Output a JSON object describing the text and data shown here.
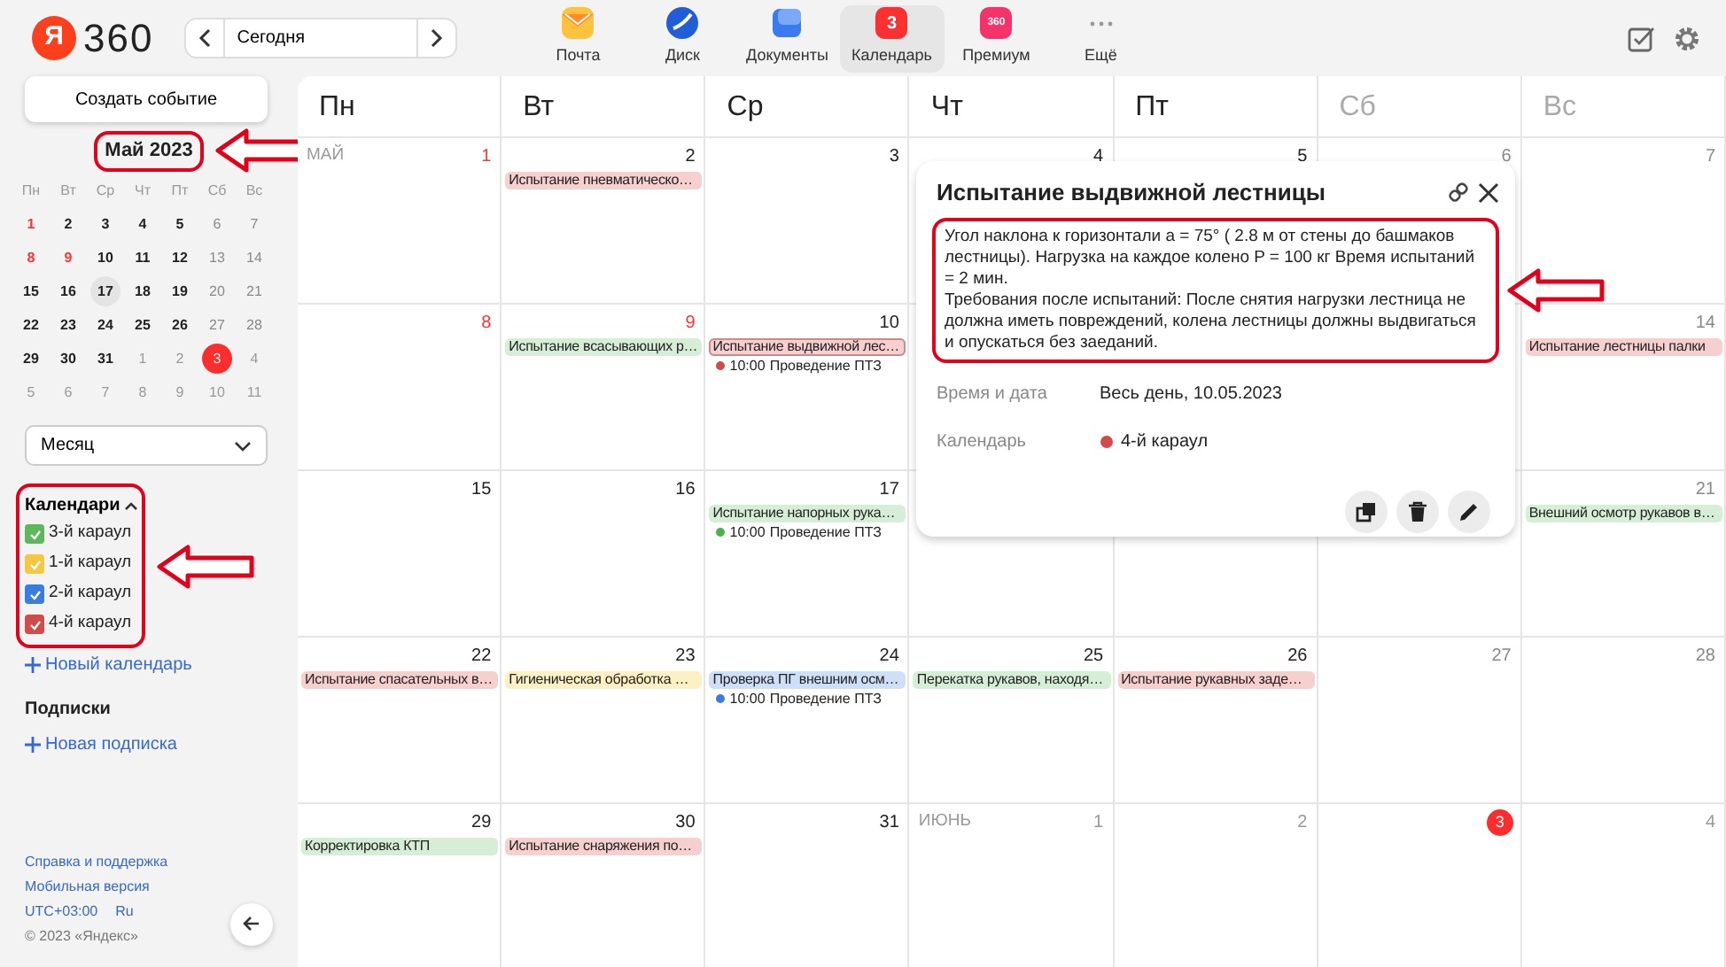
{
  "header": {
    "logo_letter": "Я",
    "logo_text": "360",
    "today_button": "Сегодня",
    "services": [
      {
        "label": "Почта",
        "kind": "mail",
        "selected": false
      },
      {
        "label": "Диск",
        "kind": "disk",
        "selected": false
      },
      {
        "label": "Документы",
        "kind": "docs",
        "selected": false
      },
      {
        "label": "Календарь",
        "kind": "calendar",
        "icon_text": "3",
        "selected": true
      },
      {
        "label": "Премиум",
        "kind": "premium",
        "icon_text": "360",
        "selected": false
      },
      {
        "label": "Ещё",
        "kind": "more",
        "selected": false
      }
    ]
  },
  "sidebar": {
    "create_button": "Создать событие",
    "mini_calendar": {
      "title": "Май 2023",
      "highlighted": true,
      "weekdays": [
        "Пн",
        "Вт",
        "Ср",
        "Чт",
        "Пт",
        "Сб",
        "Вс"
      ],
      "weeks": [
        [
          {
            "text": "1",
            "kind": "holiday",
            "selected": false
          },
          {
            "text": "2",
            "kind": "normal",
            "selected": false
          },
          {
            "text": "3",
            "kind": "normal",
            "selected": false
          },
          {
            "text": "4",
            "kind": "normal",
            "selected": false
          },
          {
            "text": "5",
            "kind": "normal",
            "selected": false
          },
          {
            "text": "6",
            "kind": "weekend",
            "selected": false
          },
          {
            "text": "7",
            "kind": "weekend",
            "selected": false
          }
        ],
        [
          {
            "text": "8",
            "kind": "holiday",
            "selected": false
          },
          {
            "text": "9",
            "kind": "holiday",
            "selected": false
          },
          {
            "text": "10",
            "kind": "normal",
            "selected": false
          },
          {
            "text": "11",
            "kind": "normal",
            "selected": false
          },
          {
            "text": "12",
            "kind": "normal",
            "selected": false
          },
          {
            "text": "13",
            "kind": "weekend",
            "selected": false
          },
          {
            "text": "14",
            "kind": "weekend",
            "selected": false
          }
        ],
        [
          {
            "text": "15",
            "kind": "normal",
            "selected": false
          },
          {
            "text": "16",
            "kind": "normal",
            "selected": false
          },
          {
            "text": "17",
            "kind": "normal",
            "selected": true
          },
          {
            "text": "18",
            "kind": "normal",
            "selected": false
          },
          {
            "text": "19",
            "kind": "normal",
            "selected": false
          },
          {
            "text": "20",
            "kind": "weekend",
            "selected": false
          },
          {
            "text": "21",
            "kind": "weekend",
            "selected": false
          }
        ],
        [
          {
            "text": "22",
            "kind": "normal",
            "selected": false
          },
          {
            "text": "23",
            "kind": "normal",
            "selected": false
          },
          {
            "text": "24",
            "kind": "normal",
            "selected": false
          },
          {
            "text": "25",
            "kind": "normal",
            "selected": false
          },
          {
            "text": "26",
            "kind": "normal",
            "selected": false
          },
          {
            "text": "27",
            "kind": "weekend",
            "selected": false
          },
          {
            "text": "28",
            "kind": "weekend",
            "selected": false
          }
        ],
        [
          {
            "text": "29",
            "kind": "normal",
            "selected": false
          },
          {
            "text": "30",
            "kind": "normal",
            "selected": false
          },
          {
            "text": "31",
            "kind": "normal",
            "selected": false
          },
          {
            "text": "1",
            "kind": "other",
            "selected": false
          },
          {
            "text": "2",
            "kind": "other",
            "selected": false
          },
          {
            "text": "3",
            "kind": "today",
            "selected": false
          },
          {
            "text": "4",
            "kind": "other",
            "selected": false
          }
        ],
        [
          {
            "text": "5",
            "kind": "other",
            "selected": false
          },
          {
            "text": "6",
            "kind": "other",
            "selected": false
          },
          {
            "text": "7",
            "kind": "other",
            "selected": false
          },
          {
            "text": "8",
            "kind": "other",
            "selected": false
          },
          {
            "text": "9",
            "kind": "other",
            "selected": false
          },
          {
            "text": "10",
            "kind": "other",
            "selected": false
          },
          {
            "text": "11",
            "kind": "other",
            "selected": false
          }
        ]
      ]
    },
    "view_select": "Месяц",
    "calendars": {
      "title": "Календари",
      "expanded": true,
      "highlighted": true,
      "items": [
        {
          "label": "3-й караул",
          "color": "#5cb85c",
          "checked": true
        },
        {
          "label": "1-й караул",
          "color": "#f5c842",
          "checked": true
        },
        {
          "label": "2-й караул",
          "color": "#3b7ddd",
          "checked": true
        },
        {
          "label": "4-й караул",
          "color": "#d14b4b",
          "checked": true
        }
      ],
      "add_link": "Новый календарь"
    },
    "subscriptions": {
      "title": "Подписки",
      "add_link": "Новая подписка"
    },
    "footer": {
      "links": [
        "Справка и поддержка",
        "Мобильная версия"
      ],
      "timezone": "UTC+03:00",
      "language": "Ru",
      "copyright": "© 2023 «Яндекс»"
    }
  },
  "calendar": {
    "weekdays": [
      {
        "label": "Пн",
        "weekend": false
      },
      {
        "label": "Вт",
        "weekend": false
      },
      {
        "label": "Ср",
        "weekend": false
      },
      {
        "label": "Чт",
        "weekend": false
      },
      {
        "label": "Пт",
        "weekend": false
      },
      {
        "label": "Сб",
        "weekend": true
      },
      {
        "label": "Вс",
        "weekend": true
      }
    ],
    "weeks": [
      [
        {
          "month_label": "МАЙ",
          "day": "1",
          "kind": "holiday"
        },
        {
          "day": "2",
          "kind": "normal",
          "events": [
            {
              "kind": "bar",
              "text": "Испытание пневматическо…",
              "color": "#f6cfcf",
              "selected": false
            }
          ]
        },
        {
          "day": "3",
          "kind": "normal"
        },
        {
          "day": "4",
          "kind": "normal"
        },
        {
          "day": "5",
          "kind": "normal"
        },
        {
          "day": "6",
          "kind": "weekend"
        },
        {
          "day": "7",
          "kind": "weekend"
        }
      ],
      [
        {
          "day": "8",
          "kind": "holiday"
        },
        {
          "day": "9",
          "kind": "holiday",
          "events": [
            {
              "kind": "bar",
              "text": "Испытание всасывающих р…",
              "color": "#d6eed6",
              "selected": false
            }
          ]
        },
        {
          "day": "10",
          "kind": "normal",
          "events": [
            {
              "kind": "bar",
              "text": "Испытание выдвижной лес…",
              "color": "#f6cfcf",
              "selected": true
            },
            {
              "kind": "timed",
              "time": "10:00",
              "text": "Проведение ПТЗ",
              "color": "#d14b4b"
            }
          ]
        },
        {
          "day": "14",
          "kind": "weekend",
          "events": [
            {
              "kind": "bar",
              "text": "Испытание лестницы палки",
              "color": "#f6cfcf",
              "selected": false
            }
          ]
        }
      ],
      [
        {
          "day": "15",
          "kind": "normal"
        },
        {
          "day": "16",
          "kind": "normal"
        },
        {
          "day": "17",
          "kind": "normal",
          "events": [
            {
              "kind": "bar",
              "text": "Испытание напорных рука…",
              "color": "#d6eed6",
              "selected": false
            },
            {
              "kind": "timed",
              "time": "10:00",
              "text": "Проведение ПТЗ",
              "color": "#4caf50"
            }
          ]
        },
        {
          "day": "21",
          "kind": "weekend",
          "events": [
            {
              "kind": "bar",
              "text": "Внешний осмотр рукавов в…",
              "color": "#d6eed6",
              "selected": false
            }
          ]
        }
      ],
      [
        {
          "day": "22",
          "kind": "normal",
          "events": [
            {
              "kind": "bar",
              "text": "Испытание спасательных в…",
              "color": "#f6cfcf",
              "selected": false
            }
          ]
        },
        {
          "day": "23",
          "kind": "normal",
          "events": [
            {
              "kind": "bar",
              "text": "Гигиеническая обработка …",
              "color": "#fdf0c4",
              "selected": false
            }
          ]
        },
        {
          "day": "24",
          "kind": "normal",
          "events": [
            {
              "kind": "bar",
              "text": "Проверка ПГ внешним осм…",
              "color": "#cfdff7",
              "selected": false
            },
            {
              "kind": "timed",
              "time": "10:00",
              "text": "Проведение ПТЗ",
              "color": "#3b7ddd"
            }
          ]
        },
        {
          "day": "25",
          "kind": "normal",
          "events": [
            {
              "kind": "bar",
              "text": "Перекатка рукавов, находя…",
              "color": "#d6eed6",
              "selected": false
            }
          ]
        },
        {
          "day": "26",
          "kind": "normal",
          "events": [
            {
              "kind": "bar",
              "text": "Испытание рукавных заде…",
              "color": "#f6cfcf",
              "selected": false
            }
          ]
        },
        {
          "day": "27",
          "kind": "weekend"
        },
        {
          "day": "28",
          "kind": "weekend"
        }
      ],
      [
        {
          "day": "29",
          "kind": "normal",
          "events": [
            {
              "kind": "bar",
              "text": "Корректировка КТП",
              "color": "#d6eed6",
              "selected": false
            }
          ]
        },
        {
          "day": "30",
          "kind": "normal",
          "events": [
            {
              "kind": "bar",
              "text": "Испытание снаряжения по…",
              "color": "#f6cfcf",
              "selected": false
            }
          ]
        },
        {
          "day": "31",
          "kind": "normal"
        },
        {
          "month_label": "ИЮНЬ",
          "day": "1",
          "kind": "other"
        },
        {
          "day": "2",
          "kind": "other"
        },
        {
          "day": "3",
          "kind": "today"
        },
        {
          "day": "4",
          "kind": "other"
        }
      ]
    ]
  },
  "event_popup": {
    "title": "Испытание выдвижной лестницы",
    "highlighted": true,
    "description": [
      "Угол наклона к горизонтали a = 75° ( 2.8 м от стены до башмаков лестницы). Нагрузка на каждое колено P = 100 кг Время испытаний = 2 мин.",
      "Требования после испытаний: После снятия нагрузки лестница не должна иметь повреждений, колена лестницы должны выдвигаться и опускаться без заеданий."
    ],
    "fields": [
      {
        "label": "Время и дата",
        "value": "Весь день, 10.05.2023"
      },
      {
        "label": "Календарь",
        "value": "4-й караул",
        "color": "#d14b4b"
      }
    ]
  }
}
